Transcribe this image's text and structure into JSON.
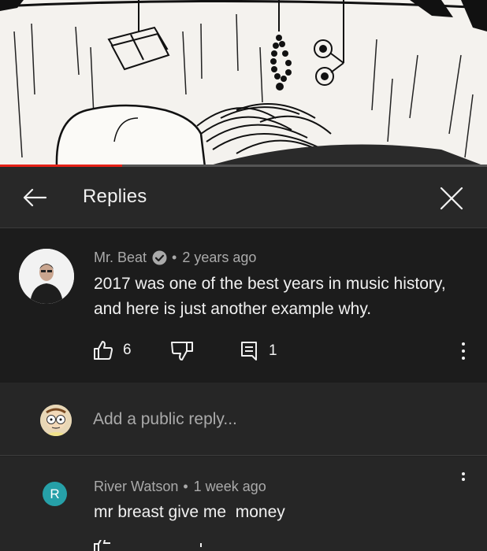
{
  "video": {
    "progress_fraction": 0.25,
    "progress_color": "#e62117"
  },
  "header": {
    "title": "Replies",
    "back_icon": "arrow-left-icon",
    "close_icon": "close-icon"
  },
  "parent_comment": {
    "author": "Mr. Beat",
    "verified": true,
    "separator": "•",
    "time": "2 years ago",
    "text": "2017 was one of the best years in music history, and here is just another example why.",
    "likes": "6",
    "replies": "1"
  },
  "add_reply": {
    "placeholder": "Add a public reply..."
  },
  "reply": {
    "avatar_letter": "R",
    "avatar_color": "#26a0a8",
    "author": "River Watson",
    "separator": "•",
    "time": "1 week ago",
    "text": "mr breast give me  money"
  }
}
